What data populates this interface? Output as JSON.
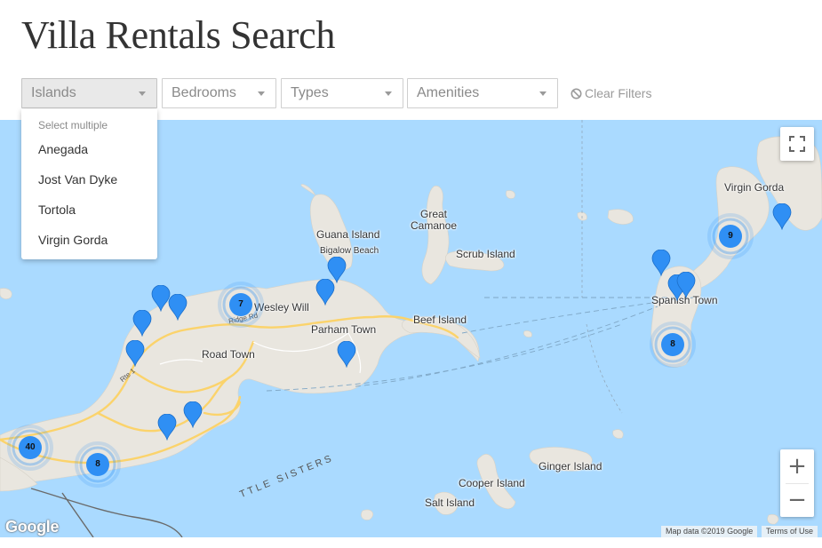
{
  "page": {
    "title": "Villa Rentals Search"
  },
  "filters": {
    "islands": {
      "label": "Islands"
    },
    "bedrooms": {
      "label": "Bedrooms"
    },
    "types": {
      "label": "Types"
    },
    "amenities": {
      "label": "Amenities"
    },
    "clear_label": "Clear Filters"
  },
  "islands_dropdown": {
    "hint": "Select multiple",
    "options": [
      "Anegada",
      "Jost Van Dyke",
      "Tortola",
      "Virgin Gorda"
    ]
  },
  "map": {
    "place_labels": {
      "virgin_gorda": "Virgin Gorda",
      "great_camanoe": "Great\nCamanoe",
      "guana_island": "Guana Island",
      "bigalow_beach": "Bigalow Beach",
      "scrub_island": "Scrub Island",
      "spanish_town": "Spanish Town",
      "wesley_will": "Wesley Will",
      "beef_island": "Beef Island",
      "parham_town": "Parham Town",
      "road_town": "Road Town",
      "ridge_rd": "Ridge Rd",
      "rte_1": "Rte 1",
      "ginger_island": "Ginger Island",
      "cooper_island": "Cooper Island",
      "salt_island": "Salt Island",
      "little_sisters": "TTLE SISTERS"
    },
    "clusters": {
      "c40": "40",
      "c8_west": "8",
      "c7": "7",
      "c9": "9",
      "c8_east": "8"
    },
    "logo": "Google",
    "attribution": {
      "map_data": "Map data ©2019 Google",
      "terms": "Terms of Use"
    },
    "zoom": {
      "in": "+",
      "out": "−"
    }
  },
  "colors": {
    "water": "#aadaff",
    "land": "#e9e6df",
    "road": "#fbd36b",
    "pin": "#2f8ff4"
  },
  "icons": [
    "ban-icon",
    "caret-down-icon",
    "map-pin-icon",
    "fullscreen-icon"
  ]
}
